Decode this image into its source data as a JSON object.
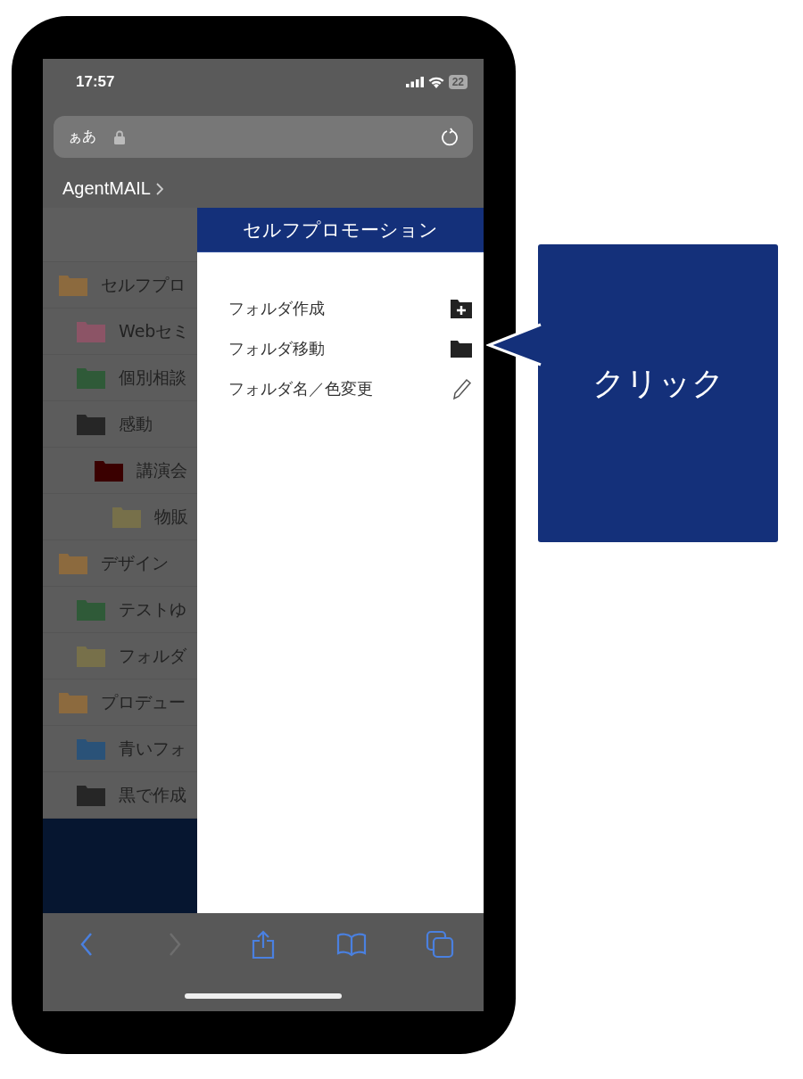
{
  "status_bar": {
    "time": "17:57",
    "battery": "22"
  },
  "address_bar": {
    "text_size": "ぁあ"
  },
  "site_title": "AgentMAIL",
  "folders": [
    {
      "name": "セルフプロ",
      "color": "#8c6a3e",
      "children": [
        {
          "name": "Webセミ",
          "color": "#8c5466"
        },
        {
          "name": "個別相談",
          "color": "#2f5a38"
        },
        {
          "name": "感動",
          "color": "#262626",
          "children": [
            {
              "name": "講演会",
              "color": "#3a0000",
              "children": [
                {
                  "name": "物販",
                  "color": "#77704a"
                }
              ]
            }
          ]
        }
      ]
    },
    {
      "name": "デザイン",
      "color": "#8c6a3e",
      "children": [
        {
          "name": "テストゆ",
          "color": "#2f5a38"
        },
        {
          "name": "フォルダ",
          "color": "#77704a"
        }
      ]
    },
    {
      "name": "プロデュー",
      "color": "#8c6a3e",
      "children": [
        {
          "name": "青いフォ",
          "color": "#2a5278"
        },
        {
          "name": "黒で作成",
          "color": "#262626"
        }
      ]
    }
  ],
  "menu": {
    "title": "セルフプロモーション",
    "items": [
      {
        "label": "フォルダ作成",
        "kind": "create"
      },
      {
        "label": "フォルダ移動",
        "kind": "move"
      },
      {
        "label": "フォルダ名／色変更",
        "kind": "rename"
      }
    ]
  },
  "toolbar": [
    {
      "kind": "back",
      "disabled": false
    },
    {
      "kind": "forward",
      "disabled": true
    },
    {
      "kind": "share",
      "disabled": false
    },
    {
      "kind": "bookmarks",
      "disabled": false
    },
    {
      "kind": "tabs",
      "disabled": false
    }
  ],
  "callout": {
    "text": "クリック"
  }
}
